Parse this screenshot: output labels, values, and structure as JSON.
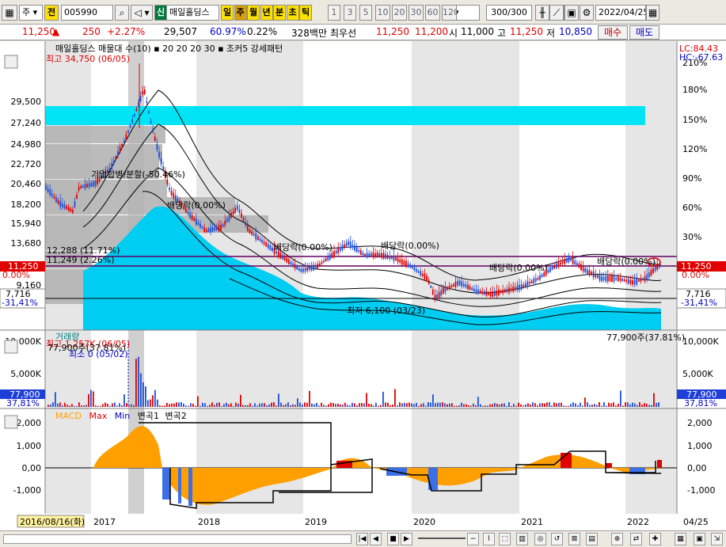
{
  "toolbar": {
    "market": "주",
    "jeon": "전",
    "code": "005990",
    "sin": "신",
    "name": "매일홀딩스",
    "periods": [
      "일",
      "주",
      "월",
      "년",
      "분",
      "초",
      "틱"
    ],
    "intervals": [
      "1",
      "3",
      "5",
      "10",
      "20",
      "30",
      "60",
      "120"
    ],
    "count": "300/300",
    "date": "2022/04/25"
  },
  "quote": {
    "price": "11,250",
    "arrow": "▲",
    "change": "250",
    "change_pct": "+2.27%",
    "volume": "29,507",
    "vol_ratio": "60.97%",
    "turnover": "0.22%",
    "amount": "328백만",
    "best_ask_label": "최우선",
    "best_ask": "11,250",
    "best_bid": "11,200",
    "open_label": "시",
    "open": "11,000",
    "high_label": "고",
    "high": "11,250",
    "low_label": "저",
    "low": "10,850",
    "buy_button": "매수",
    "sell_button": "매도"
  },
  "price_panel": {
    "legend": "매일홀딩스 매물대 수(10) ▪ 20  20  20  30 ▪ 조커5 강세패턴",
    "lc": "LC:84.43",
    "hc": "HC:-67.63",
    "high_label": "최고 34,750 (06/05)",
    "low_label": "최저 6,100 (03/23)",
    "annotations": [
      "기업합병/분할(-50.46%)",
      "배당락(0.00%)",
      "배당락(0.00%)",
      "배당락(0.00%)",
      "배당락(0.00%)",
      "배당락(0.00%)"
    ],
    "line1_label": "12,288 (11.71%)",
    "line2_label": "11,249 (2.26%)",
    "y_left_ticks": [
      "29,500",
      "27,240",
      "24,980",
      "22,720",
      "20,460",
      "18,200",
      "15,940",
      "13,680",
      "9,160"
    ],
    "y_right_ticks": [
      "210%",
      "180%",
      "150%",
      "120%",
      "90%",
      "60%",
      "30%"
    ],
    "current_left": "11,250",
    "current_left_pct": "0.00%",
    "current_right": "11,250",
    "current_right_pct": "0.00%",
    "low_tag_left": "7,716",
    "low_tag_left_pct": "-31,41%",
    "low_tag_right": "7,716",
    "low_tag_right_pct": "-31,41%"
  },
  "volume_panel": {
    "legend": "거래량",
    "max_label": "최고 1,257K (06/05)",
    "sub_label": "77,900주(37.81%)",
    "min_label": "최소 0 (05/02)",
    "right_label": "77,900주(37.81%)",
    "y_ticks": [
      "10,000K",
      "5,000K"
    ],
    "tag_left": "77,900",
    "tag_left_pct": "37,81%",
    "tag_right": "77,900",
    "tag_right_pct": "37,81%"
  },
  "macd_panel": {
    "legend_macd": "MACD",
    "legend_max": "Max",
    "legend_min": "Min",
    "legend_b1": "변곡1",
    "legend_b2": "변곡2",
    "y_ticks": [
      "2,000",
      "1,000",
      "0,00",
      "-1,000"
    ]
  },
  "x_axis": {
    "start_date": "2016/08/16(화)",
    "years": [
      "2017",
      "2018",
      "2019",
      "2020",
      "2021",
      "2022"
    ],
    "end": "04/25"
  },
  "colors": {
    "cyan": "#00d9f5",
    "up": "#e00000",
    "down": "#1e4fd8",
    "macd": "#ffa000",
    "purple": "#600060"
  }
}
